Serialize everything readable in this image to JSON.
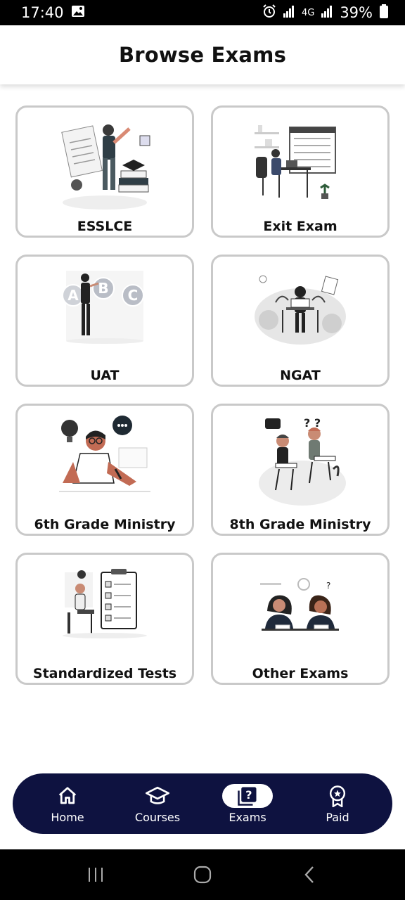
{
  "status_bar": {
    "time": "17:40",
    "network": "4G",
    "battery": "39%"
  },
  "header": {
    "title": "Browse Exams"
  },
  "exams": [
    {
      "label": "ESSLCE",
      "illustration": "student-books-illustration"
    },
    {
      "label": "Exit Exam",
      "illustration": "desk-computer-illustration"
    },
    {
      "label": "UAT",
      "illustration": "abc-choices-illustration"
    },
    {
      "label": "NGAT",
      "illustration": "woman-laptop-illustration"
    },
    {
      "label": "6th Grade Ministry",
      "illustration": "student-writing-illustration"
    },
    {
      "label": "8th Grade Ministry",
      "illustration": "two-students-illustration"
    },
    {
      "label": "Standardized Tests",
      "illustration": "checklist-illustration"
    },
    {
      "label": "Other Exams",
      "illustration": "two-girls-thinking-illustration"
    }
  ],
  "bottom_nav": [
    {
      "label": "Home",
      "icon": "home-icon",
      "active": false
    },
    {
      "label": "Courses",
      "icon": "graduation-cap-icon",
      "active": false
    },
    {
      "label": "Exams",
      "icon": "question-doc-icon",
      "active": true
    },
    {
      "label": "Paid",
      "icon": "badge-icon",
      "active": false
    }
  ],
  "colors": {
    "nav_background": "#0e1240",
    "card_border": "#c9c9c9",
    "accent": "#c26b54"
  }
}
